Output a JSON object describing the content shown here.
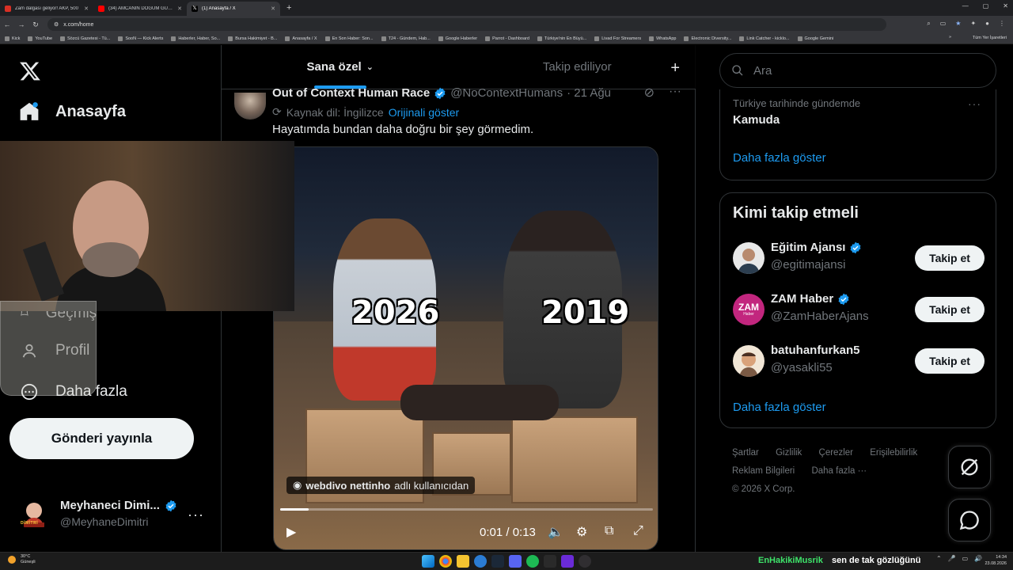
{
  "browser": {
    "tabs": [
      {
        "title": "Zam dalgası geliyor! AKP, 500",
        "favicon_color": "#d93025",
        "active": false
      },
      {
        "title": "(34) AMCANIN DOĞUM GÜNÜ",
        "favicon_color": "#ff0000",
        "active": false
      },
      {
        "title": "(1) Anasayfa / X",
        "favicon_color": "#ffffff",
        "active": true
      }
    ],
    "new_tab": "+",
    "url": "x.com/home",
    "bookmarks": [
      "Kick",
      "YouTube",
      "Sözcü Gazetesi - Tü...",
      "SooN — Kick Alerts",
      "Haberler, Haber, So...",
      "Bursa Hakimiyet - B...",
      "Anasayfa / X",
      "En Son Haber: Son...",
      "T24 - Gündem, Hab...",
      "Google Haberler",
      "Parrot - Dashboard",
      "Türkiye'nin En Büyü...",
      "Livad For Streamers",
      "WhatsApp",
      "Electronic Diversity...",
      "Link Catcher - kicklo...",
      "Google Gemini"
    ],
    "bookmarks_overflow": "»",
    "all_bookmarks": "Tüm Yer İşaretleri"
  },
  "sidebar": {
    "home_label": "Anasayfa",
    "history_label": "Geçmiş",
    "profile_label": "Profil",
    "more_label": "Daha fazla",
    "publish_label": "Gönderi yayınla",
    "account": {
      "display_name": "Meyhaneci Dimi...",
      "handle": "@MeyhaneDimitri",
      "more": "···",
      "avatar_caption": "DİMİTRİ"
    }
  },
  "timeline": {
    "tabs": [
      {
        "label": "Sana özel",
        "active": true
      },
      {
        "label": "Takip ediliyor",
        "active": false
      }
    ],
    "plus": "+",
    "tweet": {
      "name": "Out of Context Human Race",
      "handle": "@NoContextHumans",
      "date": "· 21 Ağu",
      "source_label": "Kaynak dil: İngilizce",
      "show_original": "Orijinali göster",
      "text": "Hayatımda bundan daha doğru bir şey görmedim.",
      "video": {
        "overlay_left": "2026",
        "overlay_right": "2019",
        "credit_user": "webdivo nettinho",
        "credit_suffix": "adlı kullanıcıdan",
        "time": "0:01 / 0:13",
        "progress": 0.077
      }
    }
  },
  "right": {
    "search_placeholder": "Ara",
    "trend": {
      "meta": "Türkiye tarihinde gündemde",
      "topic": "Kamuda",
      "dots": "···",
      "show_more": "Daha fazla göster"
    },
    "who_to_follow": {
      "title": "Kimi takip etmeli",
      "accounts": [
        {
          "name": "Eğitim Ajansı",
          "handle": "@egitimajansi",
          "verified": true,
          "button": "Takip et"
        },
        {
          "name": "ZAM Haber",
          "handle": "@ZamHaberAjans",
          "verified": true,
          "button": "Takip et",
          "avatar_text": "ZAM",
          "avatar_subtext": "Haber"
        },
        {
          "name": "batuhanfurkan5",
          "handle": "@yasakli55",
          "verified": false,
          "button": "Takip et"
        }
      ],
      "show_more": "Daha fazla göster"
    },
    "footer": [
      "Şartlar",
      "Gizlilik",
      "Çerezler",
      "Erişilebilirlik",
      "Reklam Bilgileri",
      "Daha fazla ···",
      "© 2026 X Corp."
    ]
  },
  "taskbar": {
    "weather_temp": "30°C",
    "weather_desc": "Güneşli",
    "ticker_user": "EnHakikiMusrik",
    "ticker_text": "sen de tak gözlüğünü",
    "time": "14:34",
    "date": "23.08.2026"
  },
  "colors": {
    "accent": "#1d9bf0",
    "background": "#000000",
    "border": "#2f3336",
    "muted_text": "#71767b"
  }
}
